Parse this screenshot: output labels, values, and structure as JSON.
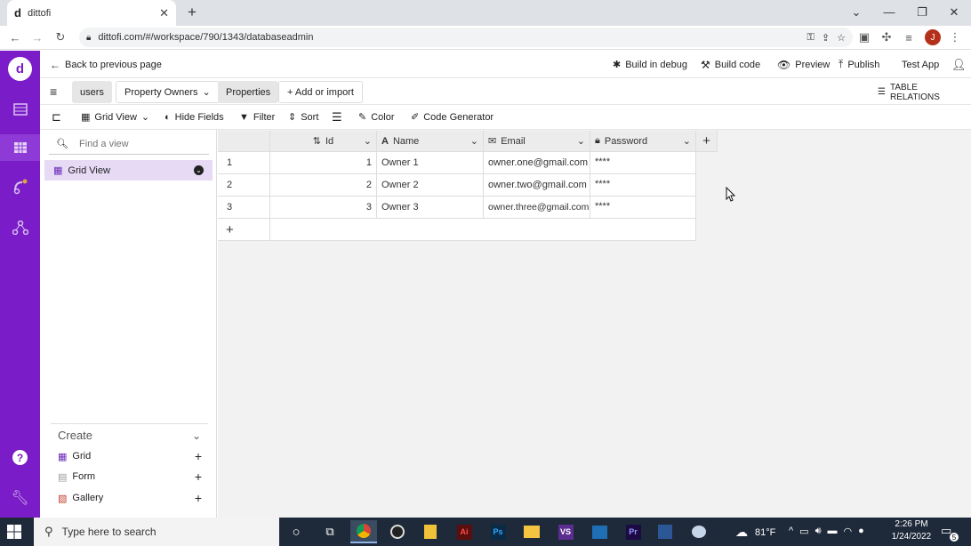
{
  "browser": {
    "tab_title": "dittofi",
    "url": "dittofi.com/#/workspace/790/1343/databaseadmin",
    "profile_initial": "J"
  },
  "header": {
    "back_label": "Back to previous page",
    "build_debug": "Build in debug",
    "build_code": "Build code",
    "preview": "Preview",
    "publish": "Publish",
    "app_name": "Test App"
  },
  "tabs": {
    "users": "users",
    "property_owners": "Property Owners",
    "properties": "Properties",
    "add_import": "+ Add or import",
    "table_relations": "TABLE RELATIONS"
  },
  "toolbar": {
    "grid_view": "Grid View",
    "hide_fields": "Hide Fields",
    "filter": "Filter",
    "sort": "Sort",
    "color": "Color",
    "code_generator": "Code Generator"
  },
  "views": {
    "search_placeholder": "Find a view",
    "active_view": "Grid View",
    "create_label": "Create",
    "create_items": [
      "Grid",
      "Form",
      "Gallery"
    ]
  },
  "grid": {
    "columns": [
      "Id",
      "Name",
      "Email",
      "Password"
    ],
    "rows": [
      {
        "num": "1",
        "id": "1",
        "name": "Owner 1",
        "email": "owner.one@gmail.com",
        "password": "****"
      },
      {
        "num": "2",
        "id": "2",
        "name": "Owner 2",
        "email": "owner.two@gmail.com",
        "password": "****"
      },
      {
        "num": "3",
        "id": "3",
        "name": "Owner 3",
        "email": "owner.three@gmail.com",
        "password": "****"
      }
    ],
    "add_row": "+",
    "add_column": "+"
  },
  "taskbar": {
    "search_placeholder": "Type here to search",
    "weather": "81°F",
    "time": "2:26 PM",
    "date": "1/24/2022",
    "notifications": "5"
  },
  "colors": {
    "brand_purple": "#7a1cc8",
    "taskbar": "#1e2a3a"
  }
}
